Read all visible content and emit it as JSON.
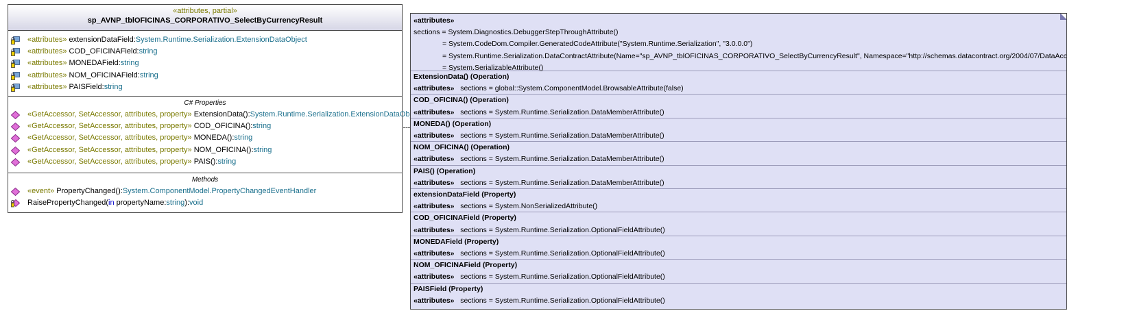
{
  "class_box": {
    "stereotype": "«attributes, partial»",
    "name": "sp_AVNP_tblOFICINAS_CORPORATIVO_SelectByCurrencyResult",
    "fields": [
      {
        "stereo": "«attributes»",
        "name": " extensionDataField:",
        "type": "System.Runtime.Serialization.ExtensionDataObject"
      },
      {
        "stereo": "«attributes»",
        "name": " COD_OFICINAField:",
        "type": "string"
      },
      {
        "stereo": "«attributes»",
        "name": " MONEDAField:",
        "type": "string"
      },
      {
        "stereo": "«attributes»",
        "name": " NOM_OFICINAField:",
        "type": "string"
      },
      {
        "stereo": "«attributes»",
        "name": " PAISField:",
        "type": "string"
      }
    ],
    "properties_title": "C# Properties",
    "properties": [
      {
        "stereo": "«GetAccessor, SetAccessor, attributes, property»",
        "name": " ExtensionData():",
        "type": "System.Runtime.Serialization.ExtensionDataObject"
      },
      {
        "stereo": "«GetAccessor, SetAccessor, attributes, property»",
        "name": " COD_OFICINA():",
        "type": "string"
      },
      {
        "stereo": "«GetAccessor, SetAccessor, attributes, property»",
        "name": " MONEDA():",
        "type": "string"
      },
      {
        "stereo": "«GetAccessor, SetAccessor, attributes, property»",
        "name": " NOM_OFICINA():",
        "type": "string"
      },
      {
        "stereo": "«GetAccessor, SetAccessor, attributes, property»",
        "name": " PAIS():",
        "type": "string"
      }
    ],
    "methods_title": "Methods",
    "methods": [
      {
        "stereo": "«event»",
        "name": " PropertyChanged():",
        "type": "System.ComponentModel.PropertyChangedEventHandler"
      },
      {
        "pre": "RaisePropertyChanged(",
        "kw": "in",
        "mid": " propertyName:",
        "type1": "string",
        "post": "):",
        "type2": "void"
      }
    ]
  },
  "note": {
    "title": "«attributes»",
    "sections_label": "sections = ",
    "header_lines": [
      "System.Diagnostics.DebuggerStepThroughAttribute()",
      "= System.CodeDom.Compiler.GeneratedCodeAttribute(\"System.Runtime.Serialization\", \"3.0.0.0\")",
      "= System.Runtime.Serialization.DataContractAttribute(Name=\"sp_AVNP_tblOFICINAS_CORPORATIVO_SelectByCurrencyResult\", Namespace=\"http://schemas.datacontract.org/2004/07/DataAccess",
      "= System.SerializableAttribute()"
    ],
    "entries": [
      {
        "title": "ExtensionData() (Operation)",
        "label": "«attributes»",
        "value": "   sections = global::System.ComponentModel.BrowsableAttribute(false)"
      },
      {
        "title": "COD_OFICINA() (Operation)",
        "label": "«attributes»",
        "value": "   sections = System.Runtime.Serialization.DataMemberAttribute()"
      },
      {
        "title": "MONEDA() (Operation)",
        "label": "«attributes»",
        "value": "   sections = System.Runtime.Serialization.DataMemberAttribute()"
      },
      {
        "title": "NOM_OFICINA() (Operation)",
        "label": "«attributes»",
        "value": "   sections = System.Runtime.Serialization.DataMemberAttribute()"
      },
      {
        "title": "PAIS() (Operation)",
        "label": "«attributes»",
        "value": "   sections = System.Runtime.Serialization.DataMemberAttribute()"
      },
      {
        "title": "extensionDataField (Property)",
        "label": "«attributes»",
        "value": "   sections = System.NonSerializedAttribute()"
      },
      {
        "title": "COD_OFICINAField (Property)",
        "label": "«attributes»",
        "value": "   sections = System.Runtime.Serialization.OptionalFieldAttribute()"
      },
      {
        "title": "MONEDAField (Property)",
        "label": "«attributes»",
        "value": "   sections = System.Runtime.Serialization.OptionalFieldAttribute()"
      },
      {
        "title": "NOM_OFICINAField (Property)",
        "label": "«attributes»",
        "value": "   sections = System.Runtime.Serialization.OptionalFieldAttribute()"
      },
      {
        "title": "PAISField (Property)",
        "label": "«attributes»",
        "value": "   sections = System.Runtime.Serialization.OptionalFieldAttribute()"
      }
    ]
  },
  "icons": {
    "field": "private-field-icon",
    "property": "property-diamond-icon",
    "event": "event-diamond-icon",
    "method": "protected-method-icon"
  },
  "colors": {
    "stereotype": "#7a7a00",
    "type": "#1a6f8c",
    "keyword": "#0000cc",
    "note_bg": "#dfe0f5",
    "property_icon": "#e070d8"
  }
}
